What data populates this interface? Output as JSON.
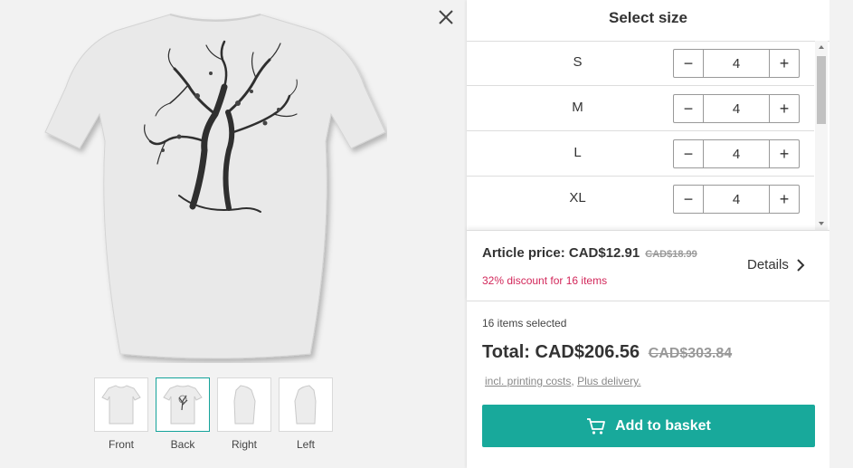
{
  "viewer": {
    "close_icon": "close-icon",
    "thumbnails": [
      {
        "label": "Front",
        "active": false
      },
      {
        "label": "Back",
        "active": true
      },
      {
        "label": "Right",
        "active": false
      },
      {
        "label": "Left",
        "active": false
      }
    ]
  },
  "panel": {
    "title": "Select size",
    "sizes": [
      {
        "label": "S",
        "qty": "4"
      },
      {
        "label": "M",
        "qty": "4"
      },
      {
        "label": "L",
        "qty": "4"
      },
      {
        "label": "XL",
        "qty": "4"
      }
    ],
    "article_price": "Article price: CAD$12.91",
    "article_price_old": "CAD$18.99",
    "discount": "32% discount for 16 items",
    "details": "Details",
    "items_selected": "16 items selected",
    "total": "Total: CAD$206.56",
    "total_old": "CAD$303.84",
    "link_printing": "incl. printing costs",
    "link_separator": ",",
    "link_delivery": "Plus delivery.",
    "basket_button": "Add to basket"
  },
  "colors": {
    "accent": "#18a99b",
    "discount": "#d2275a",
    "background": "#f2f2f2"
  }
}
